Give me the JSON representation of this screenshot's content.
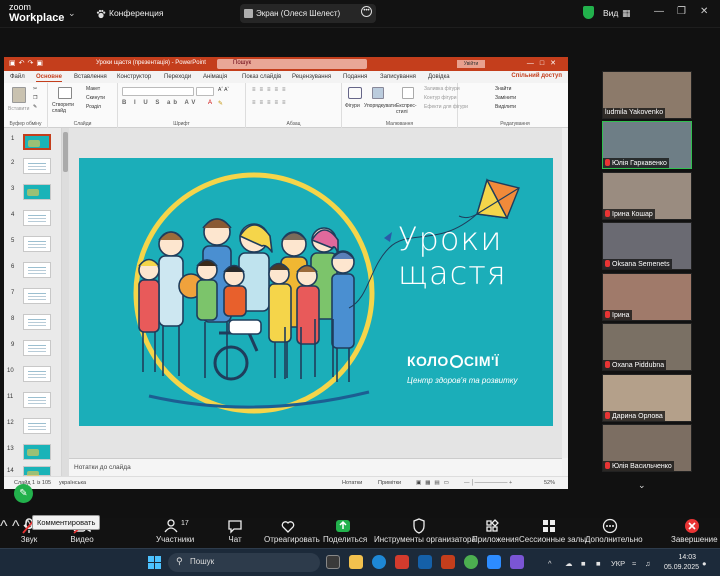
{
  "zoom": {
    "logo_line1": "zoom",
    "logo_line2": "Workplace",
    "conference_label": "Конференция",
    "share_label": "Экран (Олеся Шелест)",
    "view_label": "Вид",
    "accent_color": "#30c050"
  },
  "ppt": {
    "doc_title": "Уроки щастя (презентація) - PowerPoint",
    "search_placeholder": "Пошук",
    "login_label": "Увійти",
    "share_button": "Спільний доступ",
    "tabs": [
      "Файл",
      "Основне",
      "Вставлення",
      "Конструктор",
      "Переходи",
      "Анімація",
      "Показ слайдів",
      "Рецензування",
      "Подання",
      "Записування",
      "Довідка"
    ],
    "active_tab": "Основне",
    "ribbon": {
      "clipboard": {
        "paste": "Вставити",
        "group": "Буфер обміну"
      },
      "slides": {
        "new": "Створити слайд",
        "layout": "Макет",
        "reset": "Скинути",
        "section": "Розділ",
        "group": "Слайди"
      },
      "font": {
        "group": "Шрифт"
      },
      "paragraph": {
        "group": "Абзац"
      },
      "drawing": {
        "shapes": "Фігури",
        "arrange": "Упорядкувати",
        "quick_styles": "Експрес-стилі",
        "fill": "Заливка фігури",
        "outline": "Контур фігури",
        "effects": "Ефекти для фігури",
        "group": "Малювання"
      },
      "editing": {
        "find": "Знайти",
        "replace": "Замінити",
        "select": "Виділити",
        "group": "Редагування"
      }
    },
    "thumbnails": [
      "1",
      "2",
      "3",
      "4",
      "5",
      "6",
      "7",
      "8",
      "9",
      "10",
      "11",
      "12",
      "13",
      "14"
    ],
    "slide": {
      "title_line1": "Уроки",
      "title_line2": "щастя",
      "brand_left": "КОЛО",
      "brand_right": "СІМ'Ї",
      "brand_sub": "Центр здоров'я та розвитку",
      "bg_color": "#1baeb9"
    },
    "notes_placeholder": "Нотатки до слайда",
    "status": {
      "slide": "Слайд 1 із 105",
      "lang": "українська",
      "notes": "Нотатки",
      "comments": "Примітки",
      "zoom": "52%"
    }
  },
  "participants": [
    {
      "name": "ludmila Yakovenko",
      "muted": false,
      "active": false,
      "bg": "#8c7a6a"
    },
    {
      "name": "Юлія Гаркавенко",
      "muted": true,
      "active": true,
      "bg": "#6e7e86"
    },
    {
      "name": "Ірина Кошар",
      "muted": true,
      "active": false,
      "bg": "#9a8c80"
    },
    {
      "name": "Oksana Semenets",
      "muted": true,
      "active": false,
      "bg": "#6a6a72"
    },
    {
      "name": "Ірина",
      "muted": true,
      "active": false,
      "bg": "#a07a6a"
    },
    {
      "name": "Oxana Piddubna",
      "muted": true,
      "active": false,
      "bg": "#7a7064"
    },
    {
      "name": "Дарина Орлова",
      "muted": true,
      "active": false,
      "bg": "#b4a08a"
    },
    {
      "name": "Юлія Васильченко",
      "muted": true,
      "active": false,
      "bg": "#7c6e62"
    }
  ],
  "toolbar": {
    "audio": "Звук",
    "video": "Видео",
    "participants": "Участники",
    "participants_count": "17",
    "chat": "Чат",
    "react": "Отреагировать",
    "share": "Поделиться",
    "host_tools": "Инструменты организатора",
    "apps": "Приложения",
    "breakout": "Сессионные залы",
    "more": "Дополнительно",
    "end": "Завершение",
    "tooltip": "Комментировать"
  },
  "taskbar": {
    "search_placeholder": "Пошук",
    "lang": "УКР",
    "time": "14:03",
    "date": "05.09.2025"
  }
}
